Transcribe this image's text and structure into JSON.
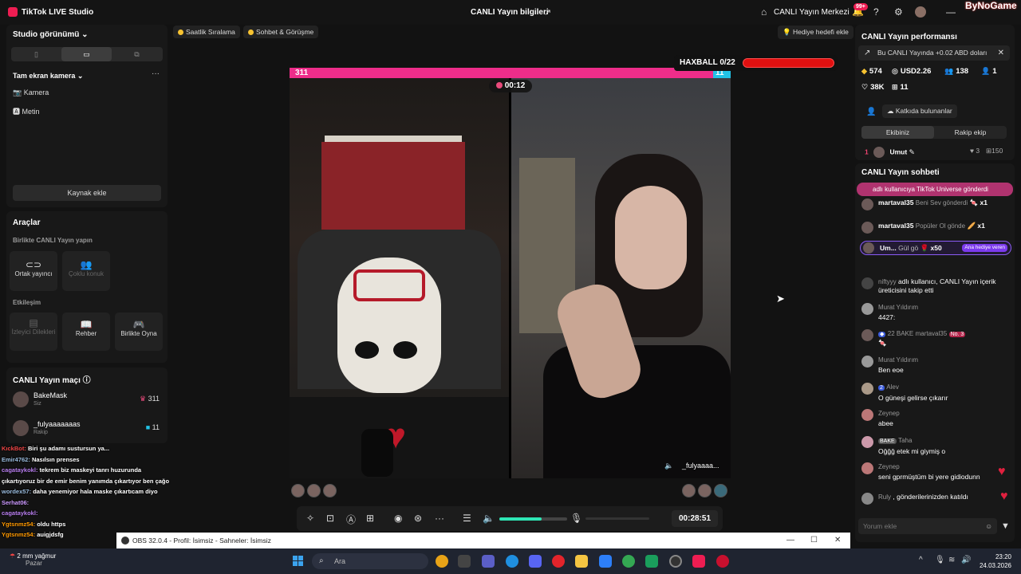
{
  "titlebar": {
    "app_name": "TikTok LIVE Studio",
    "center_title": "CANLI Yayın bilgileri",
    "live_center": "CANLI Yayın Merkezi",
    "notif_badge": "99+",
    "brand": "ByNoGame"
  },
  "left": {
    "studio_view": "Studio görünümü",
    "fullscreen_camera": "Tam ekran kamera",
    "sources": [
      "Kamera",
      "Metin"
    ],
    "add_source": "Kaynak ekle",
    "tools_title": "Araçlar",
    "live_together": "Birlikte CANLI Yayın yapın",
    "cohost": "Ortak yayıncı",
    "multi_guest": "Çoklu konuk",
    "interaction": "Etkileşim",
    "viewer_requests": "İzleyici Dilekleri",
    "guide": "Rehber",
    "play_together": "Birlikte Oyna",
    "match_title": "CANLI Yayın maçı",
    "match": [
      {
        "name": "BakeMask",
        "role": "Siz",
        "score": "311"
      },
      {
        "name": "_fulyaaaaaaas",
        "role": "Rakip",
        "score": "11"
      }
    ]
  },
  "overlay_chat": [
    {
      "user": "KıckBot:",
      "text": "Biri şu adamı sustursun ya..."
    },
    {
      "user": "Emir4762:",
      "text": "Nasılsın prenses"
    },
    {
      "user": "cagataykokl:",
      "text": "tekrem biz maskeyi tanrı huzurunda"
    },
    {
      "user": "",
      "text": "çıkartıyoruz bir de emir benim yanımda çıkartıyor ben çağo"
    },
    {
      "user": "wordex57:",
      "text": "daha yenemiyor hala maske çıkartıcam diyo"
    },
    {
      "user": "Serhat06:",
      "text": ""
    },
    {
      "user": "cagataykokl:",
      "text": ""
    },
    {
      "user": "Ygtsnmz54:",
      "text": "oldu https"
    },
    {
      "user": "Ygtsnmz54:",
      "text": "auigjdsfg"
    }
  ],
  "chips": {
    "hourly": "Saatlik Sıralama",
    "chat_meet": "Sohbet & Görüşme",
    "gift_goal": "Hediye hedefi ekle"
  },
  "battle": {
    "left_score": "311",
    "right_score": "11",
    "timer": "00:12",
    "opponent": "_fulyaaaa...",
    "left_share_percent": 96
  },
  "haxball": {
    "label": "HAXBALL 0/22"
  },
  "controls": {
    "duration": "00:28:51",
    "volume_percent": 62
  },
  "right": {
    "perf_title": "CANLI Yayın performansı",
    "perf_note": "Bu CANLI Yayında +0.02 ABD doları",
    "stats": {
      "coins": "574",
      "usd": "USD2.26",
      "viewers": "138",
      "follows": "1",
      "likes": "38K",
      "gifts": "11"
    },
    "contributors": "Katkıda bulunanlar",
    "tab_team": "Ekibiniz",
    "tab_rival": "Rakip ekip",
    "rank": {
      "pos": "1",
      "name": "Umut",
      "a": "3",
      "b": "150"
    },
    "chat_title": "CANLI Yayın sohbeti",
    "gift_banner": "adlı kullanıcıya TikTok Universe gönderdi",
    "messages": [
      {
        "name": "martaval35",
        "text": "Beni Sev gönderdi",
        "count": "x1"
      },
      {
        "name": "martaval35",
        "text": "Popüler Ol gönde",
        "count": "x1"
      },
      {
        "name": "Um...",
        "text": "Gül gö",
        "count": "x50",
        "badge": "Ana hediye veren"
      },
      {
        "name": "niftyyy",
        "text": "adlı kullanıcı, CANLI Yayın içerik"
      },
      {
        "name": "",
        "text": "üreticisini takip etti"
      },
      {
        "name": "Murat Yıldırım",
        "text": "4427:"
      },
      {
        "name": "martaval35",
        "text": "22  BAKE",
        "extra": "No. 3"
      },
      {
        "name": "Murat Yıldırım",
        "text": "Ben eoe"
      },
      {
        "name": "Alev",
        "text": "2",
        "body": "O güneşi gelirse çıkarır"
      },
      {
        "name": "Zeynep",
        "text": "",
        "body": "abee"
      },
      {
        "name": "Taha",
        "text": "BAKE",
        "body": "Oğğğ etek mi giymiş o"
      },
      {
        "name": "Zeynep",
        "text": "",
        "body": "seni gprmüştüm bi yere gidiodunn"
      },
      {
        "name": "Ruly",
        "text": ", gönderilerinizden katıldı"
      }
    ],
    "comment_placeholder": "Yorum ekle"
  },
  "obs": {
    "title": "OBS 32.0.4 - Profil: İsimsiz - Sahneler: İsimsiz"
  },
  "taskbar": {
    "weather": "2 mm yağmur",
    "weather_sub": "Pazar",
    "search": "Ara",
    "time": "23:20",
    "date": "24.03.2026"
  }
}
